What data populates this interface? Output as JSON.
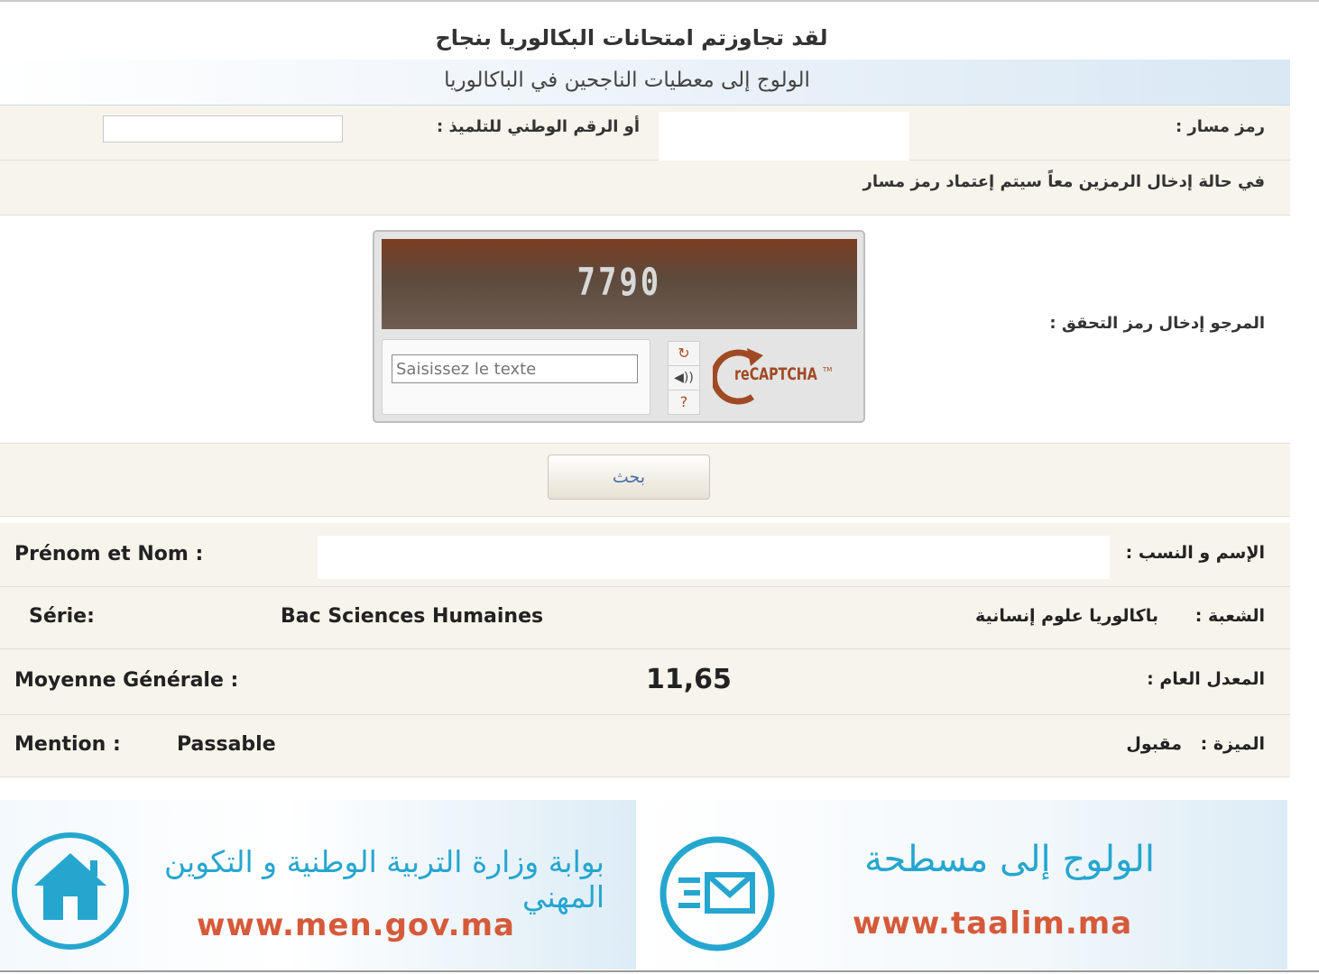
{
  "header": {
    "title": "لقد تجاوزتم امتحانات البكالوريا بنجاح",
    "subtitle": "الولوج إلى معطيات الناجحين في الباكالوريا"
  },
  "form": {
    "massar_label": "رمز مسار :",
    "national_label": "أو الرقم الوطني للتلميذ :",
    "both_codes_note": "في حالة إدخال الرمزين معاً سيتم إعتماد رمز مسار",
    "captcha_label": "المرجو إدخال رمز التحقق :",
    "search_label": "بحث"
  },
  "captcha": {
    "image_text": "7790",
    "input_placeholder": "Saisissez le texte",
    "refresh_glyph": "↻",
    "audio_glyph": "◀))",
    "help_glyph": "?",
    "logo_text": "reCAPTCHA",
    "logo_tm": "TM"
  },
  "results": {
    "name_label_fr": "Prénom et Nom :",
    "name_label_ar": "الإسم و النسب :",
    "serie_label_fr": "Série:",
    "serie_value_fr": "Bac Sciences Humaines",
    "serie_value_ar": "باكالوريا علوم إنسانية",
    "serie_label_ar": "الشعبة :",
    "moyenne_label_fr": "Moyenne Générale :",
    "moyenne_value": "11,65",
    "moyenne_label_ar": "المعدل العام :",
    "mention_label_fr": "Mention :",
    "mention_value_fr": "Passable",
    "mention_value_ar": "مقبول",
    "mention_label_ar": "الميزة :"
  },
  "banners": {
    "men": {
      "title": "بوابة وزارة التربية الوطنية و التكوين المهني",
      "url": "www.men.gov.ma",
      "icon": "home-icon"
    },
    "taalim": {
      "title": "الولوج إلى مسطحة",
      "url": "www.taalim.ma",
      "icon": "mail-icon"
    }
  },
  "colors": {
    "accent_blue": "#25a6cf",
    "url_orange": "#d55a3a",
    "row_bg": "#f7f4ec",
    "recaptcha_orange": "#a04a24"
  }
}
